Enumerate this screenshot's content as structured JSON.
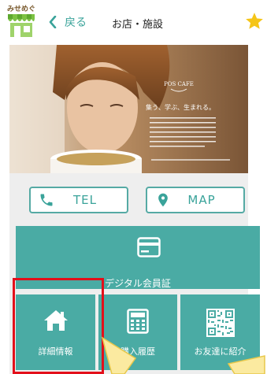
{
  "header": {
    "logo_text": "みせめぐ",
    "back_label": "戻る",
    "title": "お店・施設"
  },
  "hero": {
    "brand": "POS CAFE",
    "tagline": "集う、学ぶ、生まれる。"
  },
  "actions": {
    "tel_label": "TEL",
    "map_label": "MAP"
  },
  "tiles": {
    "member_card": "デジタル会員証",
    "detail": "詳細情報",
    "history": "購入履歴",
    "friend": "お友達に紹介"
  },
  "colors": {
    "accent": "#4aaba4",
    "highlight": "#e30f1a",
    "star": "#f5c518"
  }
}
